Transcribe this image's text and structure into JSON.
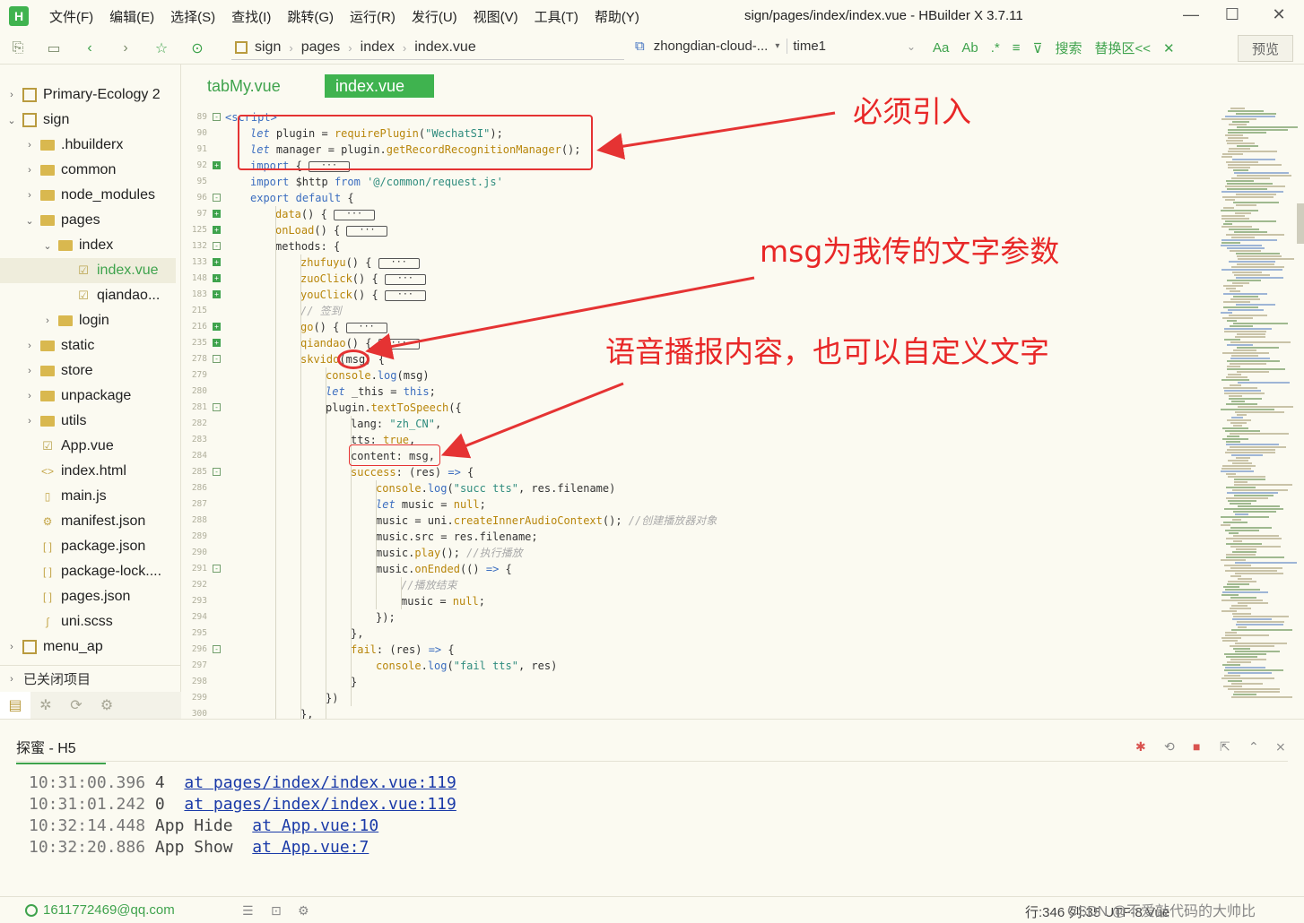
{
  "window": {
    "logo": "H",
    "title": "sign/pages/index/index.vue - HBuilder X 3.7.11",
    "menu": [
      "文件(F)",
      "编辑(E)",
      "选择(S)",
      "查找(I)",
      "跳转(G)",
      "运行(R)",
      "发行(U)",
      "视图(V)",
      "工具(T)",
      "帮助(Y)"
    ],
    "minimize": "—",
    "maximize": "☐",
    "close": "✕"
  },
  "toolbar": {
    "breadcrumb": [
      "sign",
      "pages",
      "index",
      "index.vue"
    ],
    "device": "zhongdian-cloud-...",
    "branch": "time1",
    "search_label": "搜索",
    "replace_label": "替换区<<",
    "preview_label": "预览"
  },
  "sidebar": {
    "items": [
      {
        "label": "Primary-Ecology 2",
        "depth": 0,
        "type": "project",
        "chev": "›"
      },
      {
        "label": "sign",
        "depth": 0,
        "type": "project",
        "chev": "⌄"
      },
      {
        "label": ".hbuilderx",
        "depth": 1,
        "type": "folder",
        "chev": "›"
      },
      {
        "label": "common",
        "depth": 1,
        "type": "folder",
        "chev": "›"
      },
      {
        "label": "node_modules",
        "depth": 1,
        "type": "folder",
        "chev": "›"
      },
      {
        "label": "pages",
        "depth": 1,
        "type": "folder",
        "chev": "⌄"
      },
      {
        "label": "index",
        "depth": 2,
        "type": "folder",
        "chev": "⌄"
      },
      {
        "label": "index.vue",
        "depth": 3,
        "type": "vue",
        "chev": "",
        "selected": true
      },
      {
        "label": "qiandao...",
        "depth": 3,
        "type": "vue",
        "chev": ""
      },
      {
        "label": "login",
        "depth": 2,
        "type": "folder",
        "chev": "›"
      },
      {
        "label": "static",
        "depth": 1,
        "type": "folder",
        "chev": "›"
      },
      {
        "label": "store",
        "depth": 1,
        "type": "folder",
        "chev": "›"
      },
      {
        "label": "unpackage",
        "depth": 1,
        "type": "folder",
        "chev": "›"
      },
      {
        "label": "utils",
        "depth": 1,
        "type": "folder",
        "chev": "›"
      },
      {
        "label": "App.vue",
        "depth": 1,
        "type": "vue",
        "chev": ""
      },
      {
        "label": "index.html",
        "depth": 1,
        "type": "html",
        "chev": ""
      },
      {
        "label": "main.js",
        "depth": 1,
        "type": "js",
        "chev": ""
      },
      {
        "label": "manifest.json",
        "depth": 1,
        "type": "manifest",
        "chev": ""
      },
      {
        "label": "package.json",
        "depth": 1,
        "type": "json",
        "chev": ""
      },
      {
        "label": "package-lock....",
        "depth": 1,
        "type": "json",
        "chev": ""
      },
      {
        "label": "pages.json",
        "depth": 1,
        "type": "json",
        "chev": ""
      },
      {
        "label": "uni.scss",
        "depth": 1,
        "type": "scss",
        "chev": ""
      },
      {
        "label": "menu_ap",
        "depth": 0,
        "type": "project",
        "chev": "›"
      }
    ],
    "closed_projects": "已关闭项目"
  },
  "editor": {
    "tabs": [
      "tabMy.vue",
      "index.vue"
    ],
    "active_tab": 1,
    "collapsed_marker": "···"
  },
  "code_lines": [
    {
      "n": "89",
      "fold": "-",
      "indent": 0,
      "html": "<span class='k2'>&lt;script&gt;</span>"
    },
    {
      "n": "90",
      "fold": "",
      "indent": 1,
      "html": "<span class='kw'>let</span> plugin = <span class='fn'>requirePlugin</span>(<span class='str'>\"WechatSI\"</span>);"
    },
    {
      "n": "91",
      "fold": "",
      "indent": 1,
      "html": "<span class='kw'>let</span> manager = plugin.<span class='fn'>getRecordRecognitionManager</span>();"
    },
    {
      "n": "92",
      "fold": "+",
      "indent": 1,
      "html": "<span class='k2'>import</span> { <span class='collapsed'>···</span>"
    },
    {
      "n": "95",
      "fold": "",
      "indent": 1,
      "html": "<span class='k2'>import</span> $http <span class='k2'>from</span> <span class='str'>'@/common/request.js'</span>"
    },
    {
      "n": "96",
      "fold": "-",
      "indent": 1,
      "html": "<span class='k2'>export</span> <span class='k2'>default</span> {"
    },
    {
      "n": "97",
      "fold": "+",
      "indent": 2,
      "html": "<span class='fn'>data</span>() { <span class='collapsed'>···</span>"
    },
    {
      "n": "125",
      "fold": "+",
      "indent": 2,
      "html": "<span class='fn'>onLoad</span>() { <span class='collapsed'>···</span>"
    },
    {
      "n": "132",
      "fold": "-",
      "indent": 2,
      "html": "methods: {"
    },
    {
      "n": "133",
      "fold": "+",
      "indent": 3,
      "html": "<span class='fn'>zhufuyu</span>() { <span class='collapsed'>···</span>"
    },
    {
      "n": "148",
      "fold": "+",
      "indent": 3,
      "html": "<span class='fn'>zuoClick</span>() { <span class='collapsed'>···</span>"
    },
    {
      "n": "183",
      "fold": "+",
      "indent": 3,
      "html": "<span class='fn'>youClick</span>() { <span class='collapsed'>···</span>"
    },
    {
      "n": "215",
      "fold": "",
      "indent": 3,
      "html": "<span class='cm'>// 签到</span>"
    },
    {
      "n": "216",
      "fold": "+",
      "indent": 3,
      "html": "<span class='fn'>go</span>() { <span class='collapsed'>···</span>"
    },
    {
      "n": "235",
      "fold": "+",
      "indent": 3,
      "html": "<span class='fn'>qiandao</span>() { <span class='collapsed'>···</span>"
    },
    {
      "n": "278",
      "fold": "-",
      "indent": 3,
      "html": "<span class='fn'>skvido</span>(msg) {"
    },
    {
      "n": "279",
      "fold": "",
      "indent": 4,
      "html": "<span class='fn'>console</span>.<span class='k2'>log</span>(msg)"
    },
    {
      "n": "280",
      "fold": "",
      "indent": 4,
      "html": "<span class='kw'>let</span> _this = <span class='k2'>this</span>;"
    },
    {
      "n": "281",
      "fold": "-",
      "indent": 4,
      "html": "plugin.<span class='fn'>textToSpeech</span>({"
    },
    {
      "n": "282",
      "fold": "",
      "indent": 5,
      "html": "lang: <span class='str'>\"zh_CN\"</span>,"
    },
    {
      "n": "283",
      "fold": "",
      "indent": 5,
      "html": "tts: <span class='fn'>true</span>,"
    },
    {
      "n": "284",
      "fold": "",
      "indent": 5,
      "html": "content: msg,"
    },
    {
      "n": "285",
      "fold": "-",
      "indent": 5,
      "html": "<span class='fn'>success</span>: (res) <span class='k2'>=&gt;</span> {"
    },
    {
      "n": "286",
      "fold": "",
      "indent": 6,
      "html": "<span class='fn'>console</span>.<span class='k2'>log</span>(<span class='str'>\"succ tts\"</span>, res.filename)"
    },
    {
      "n": "287",
      "fold": "",
      "indent": 6,
      "html": "<span class='kw'>let</span> music = <span class='fn'>null</span>;"
    },
    {
      "n": "288",
      "fold": "",
      "indent": 6,
      "html": "music = uni.<span class='fn'>createInnerAudioContext</span>(); <span class='cm'>//创建播放器对象</span>"
    },
    {
      "n": "289",
      "fold": "",
      "indent": 6,
      "html": "music.src = res.filename;"
    },
    {
      "n": "290",
      "fold": "",
      "indent": 6,
      "html": "music.<span class='fn'>play</span>(); <span class='cm'>//执行播放</span>"
    },
    {
      "n": "291",
      "fold": "-",
      "indent": 6,
      "html": "music.<span class='fn'>onEnded</span>(() <span class='k2'>=&gt;</span> {"
    },
    {
      "n": "292",
      "fold": "",
      "indent": 7,
      "html": "<span class='cm'>//播放结束</span>"
    },
    {
      "n": "293",
      "fold": "",
      "indent": 7,
      "html": "music = <span class='fn'>null</span>;"
    },
    {
      "n": "294",
      "fold": "",
      "indent": 6,
      "html": "});"
    },
    {
      "n": "295",
      "fold": "",
      "indent": 5,
      "html": "},"
    },
    {
      "n": "296",
      "fold": "-",
      "indent": 5,
      "html": "<span class='fn'>fail</span>: (res) <span class='k2'>=&gt;</span> {"
    },
    {
      "n": "297",
      "fold": "",
      "indent": 6,
      "html": "<span class='fn'>console</span>.<span class='k2'>log</span>(<span class='str'>\"fail tts\"</span>, res)"
    },
    {
      "n": "298",
      "fold": "",
      "indent": 5,
      "html": "}"
    },
    {
      "n": "299",
      "fold": "",
      "indent": 4,
      "html": "})"
    },
    {
      "n": "300",
      "fold": "",
      "indent": 3,
      "html": "},"
    }
  ],
  "annotations": {
    "must_import": "必须引入",
    "msg_param": "msg为我传的文字参数",
    "speech_content": "语音播报内容，也可以自定义文字"
  },
  "console": {
    "tab": "探蜜 - H5",
    "logs": [
      {
        "time": "10:31:00.396",
        "text": "4",
        "link": "at pages/index/index.vue:119"
      },
      {
        "time": "10:31:01.242",
        "text": "0",
        "link": "at pages/index/index.vue:119"
      },
      {
        "time": "10:32:14.448",
        "text": "App Hide",
        "link": "at App.vue:10"
      },
      {
        "time": "10:32:20.886",
        "text": "App Show",
        "link": "at App.vue:7"
      }
    ]
  },
  "statusbar": {
    "user": "1611772469@qq.com",
    "cursor": "行:346  列:35    UTF-8    Vue",
    "watermark": "CSDN @不爱敲代码的大帅比"
  },
  "colors": {
    "accent": "#3fb34f",
    "annotation": "#e53333",
    "link": "#1a3aa8"
  }
}
